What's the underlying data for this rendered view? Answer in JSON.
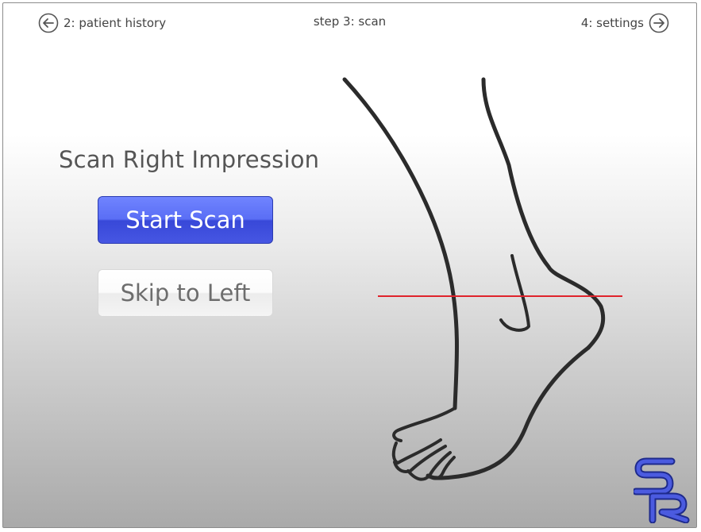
{
  "nav": {
    "back_label": "2: patient history",
    "step_label": "step 3: scan",
    "next_label": "4: settings"
  },
  "main": {
    "heading": "Scan Right Impression",
    "start_button_label": "Start Scan",
    "skip_button_label": "Skip to Left"
  },
  "icons": {
    "back": "arrow-left-circle-icon",
    "next": "arrow-right-circle-icon",
    "illustration": "foot-outline-icon",
    "logo": "sr-logo"
  },
  "logo_text": "SR",
  "colors": {
    "accent": "#5a6ef5",
    "scan_line": "#e0242c",
    "logo": "#3a47c6"
  }
}
